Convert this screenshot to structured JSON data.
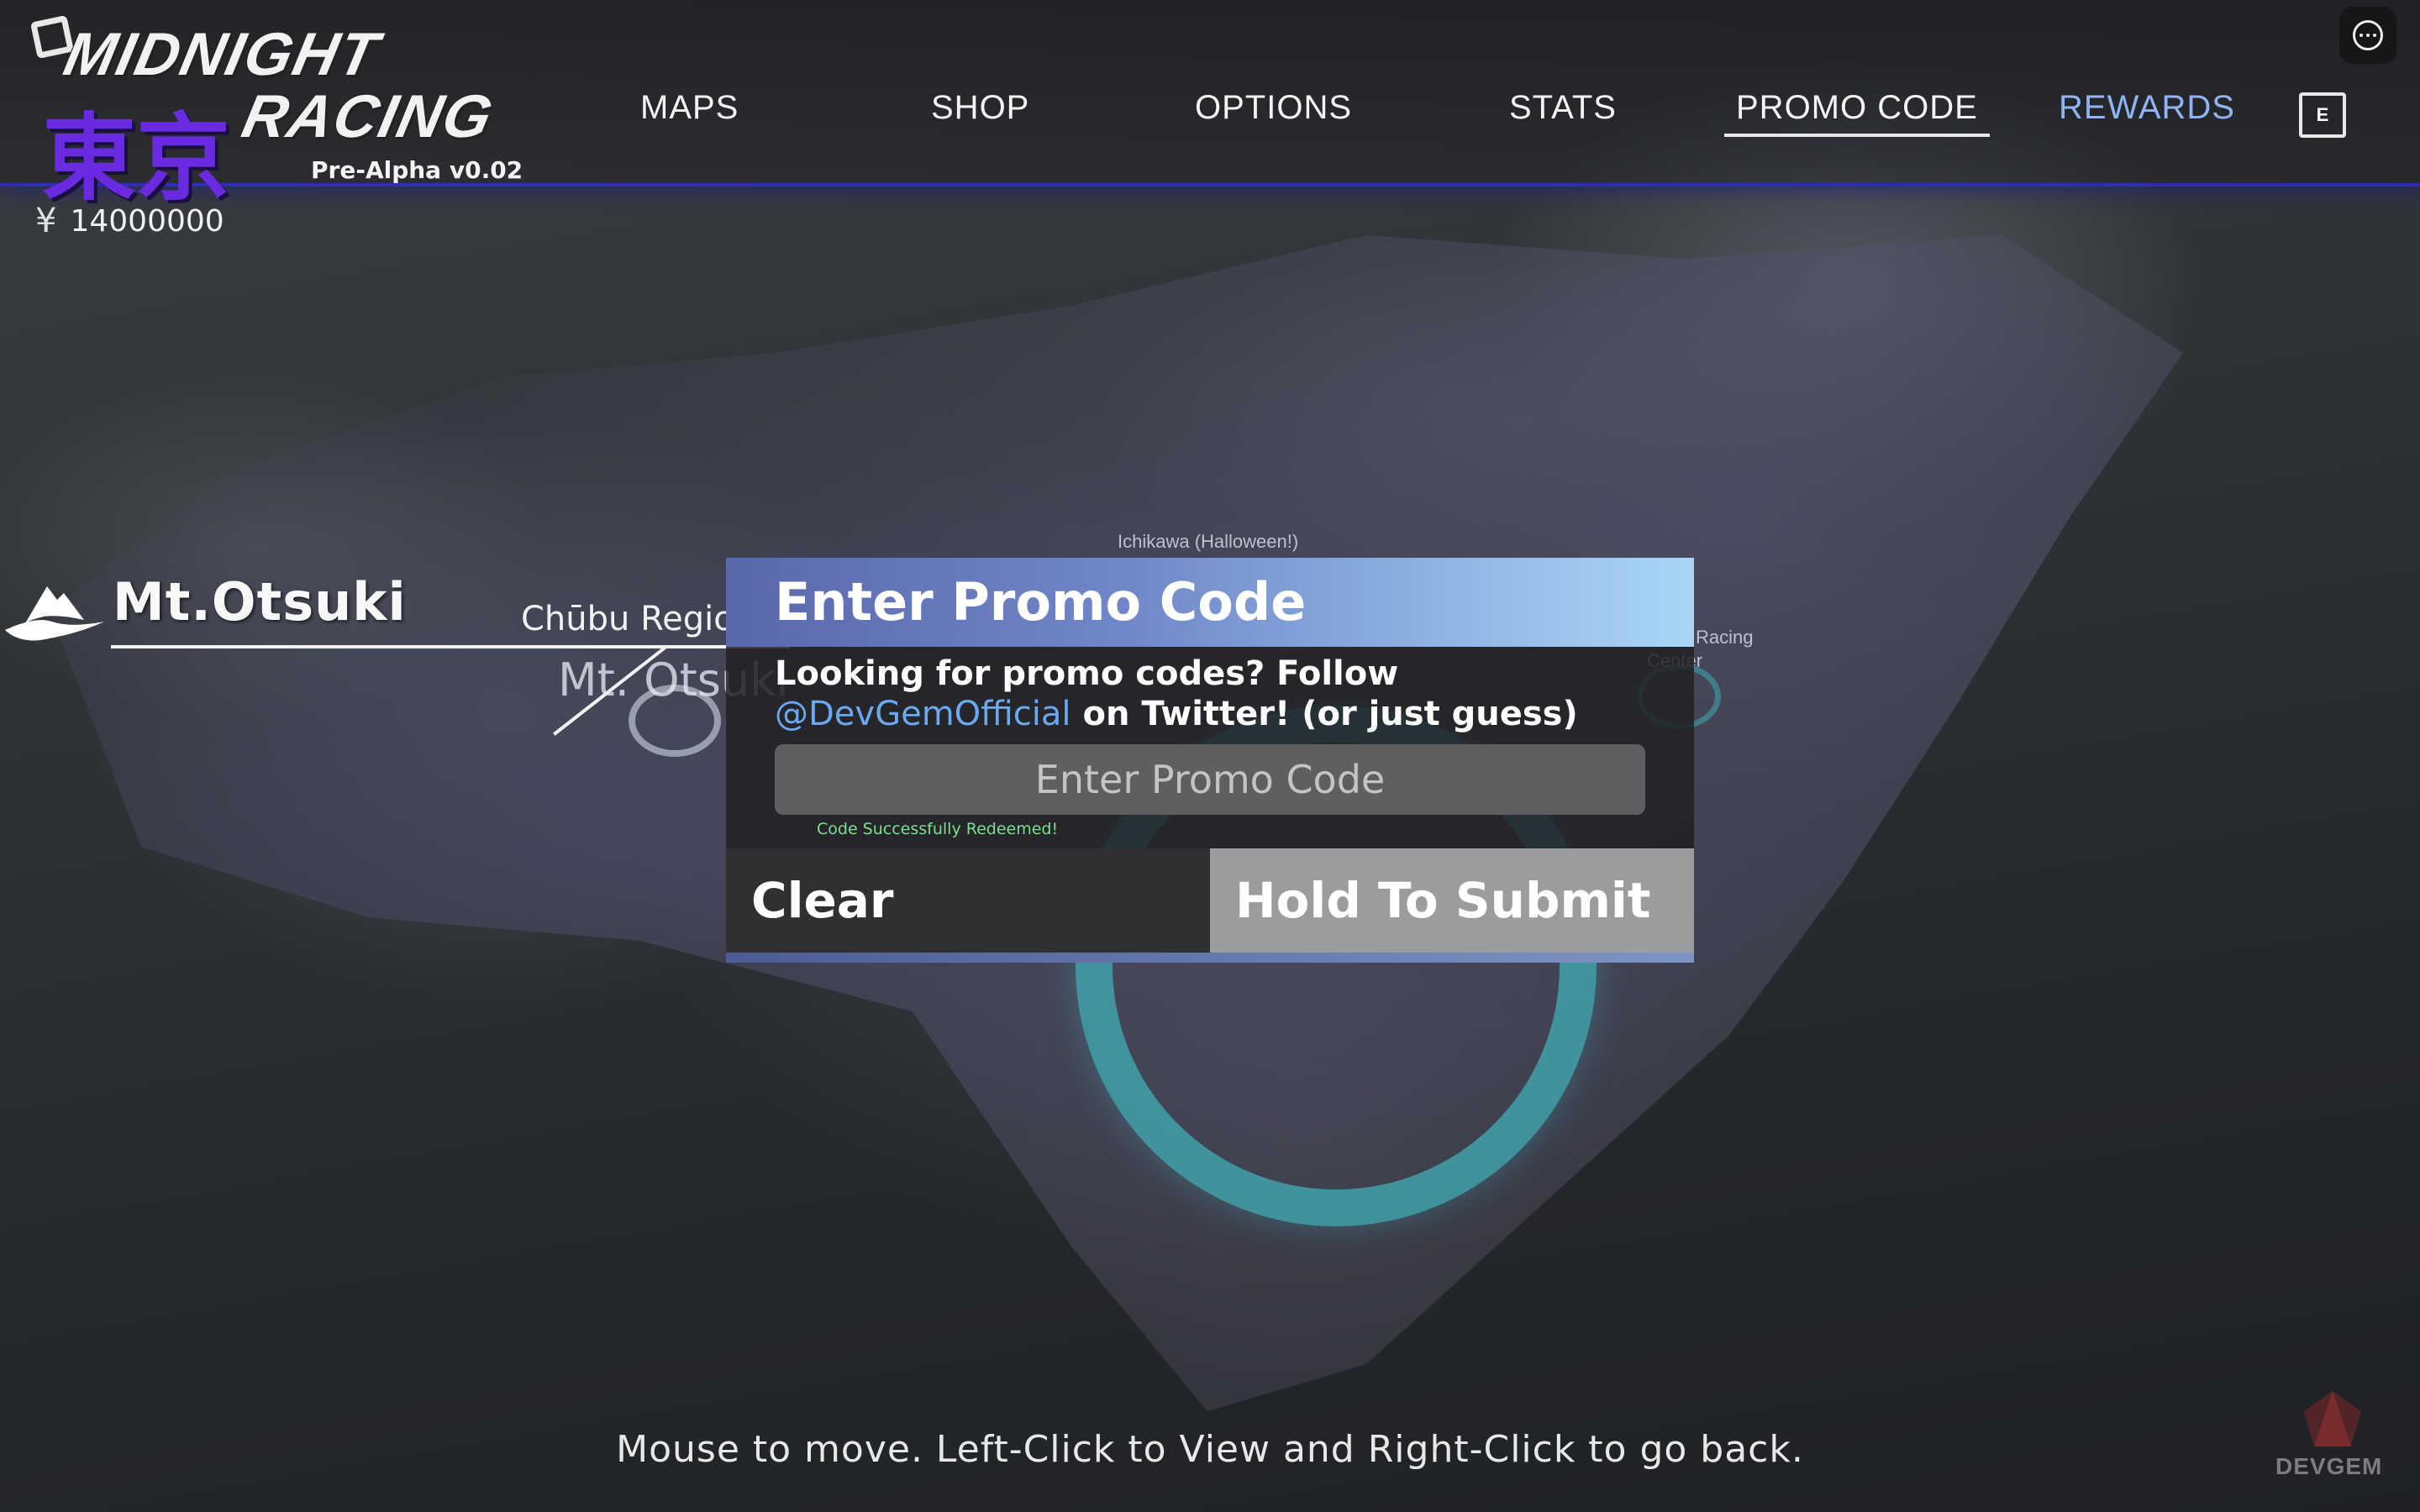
{
  "logo": {
    "line1": "MIDNIGHT",
    "kanji": "東京",
    "line2": "RACING",
    "version": "Pre-Alpha v0.02"
  },
  "nav": {
    "items": [
      {
        "label": "MAPS"
      },
      {
        "label": "SHOP"
      },
      {
        "label": "OPTIONS"
      },
      {
        "label": "STATS"
      },
      {
        "label": "PROMO CODE"
      },
      {
        "label": "REWARDS"
      }
    ],
    "active": "PROMO CODE",
    "key_hint": "E"
  },
  "currency": {
    "symbol": "¥",
    "amount": "14000000"
  },
  "location": {
    "name": "Mt.Otsuki",
    "region": "Chūbu Region",
    "map_label": "Mt. Otsuki"
  },
  "map_labels": {
    "top": "Ichikawa (Halloween!)",
    "right_line1": "Racing",
    "right_line2": "Center"
  },
  "promo_modal": {
    "title": "Enter Promo Code",
    "description_part1": "Looking for promo codes? Follow",
    "twitter_handle": "@DevGemOfficial",
    "description_part2": " on Twitter! (or just guess)",
    "input_value": "",
    "input_placeholder": "Enter Promo Code",
    "status": "Code Successfully Redeemed!",
    "clear_label": "Clear",
    "submit_label": "Hold To Submit"
  },
  "hint": "Mouse to move. Left-Click to View and Right-Click to go back.",
  "watermark": "DEVGEM",
  "colors": {
    "accent_bar": "#2d2eb8",
    "twitter_link": "#6aa8f0",
    "status_success": "#78e28a",
    "rewards_nav": "#8fb4f4",
    "ring": "#40aab4"
  }
}
